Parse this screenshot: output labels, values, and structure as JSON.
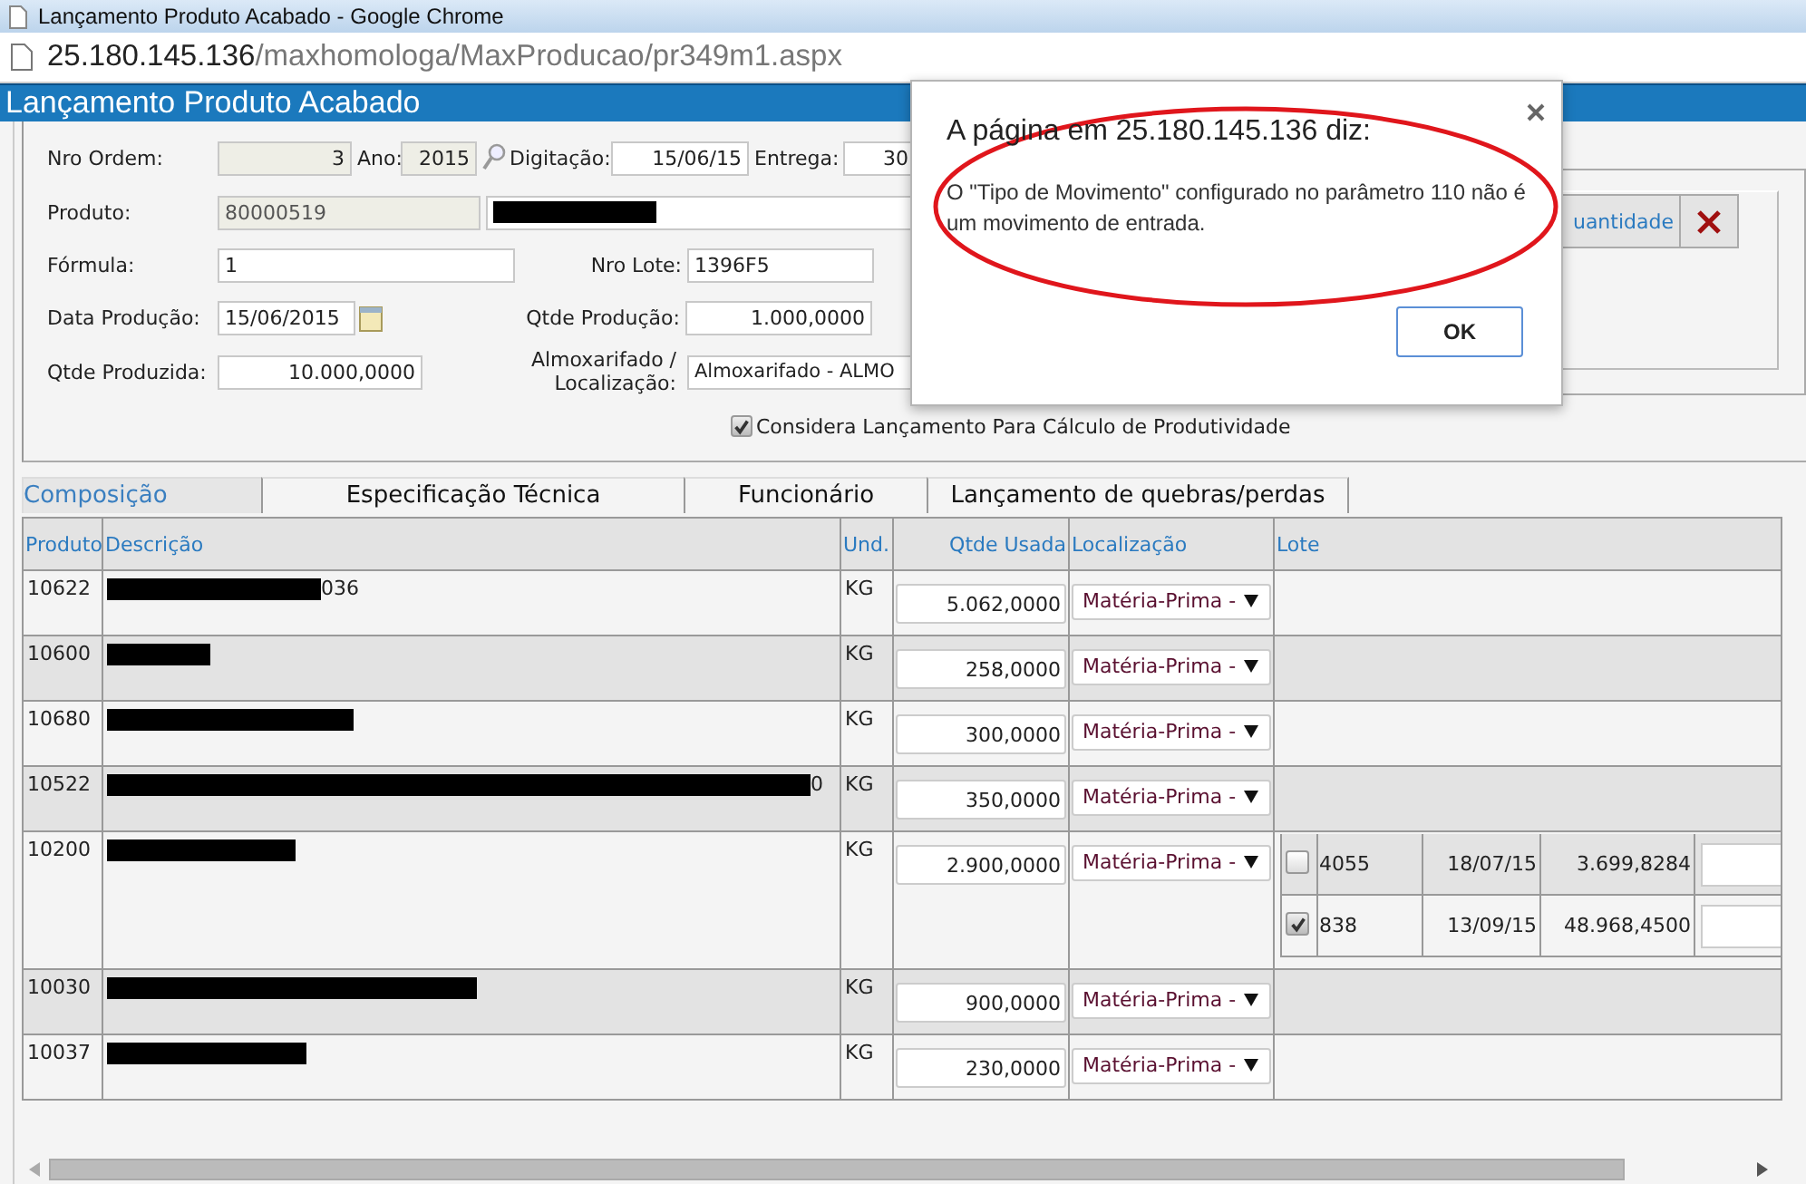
{
  "window": {
    "title": "Lançamento Produto Acabado - Google Chrome"
  },
  "address_bar": {
    "host": "25.180.145.136",
    "path": "/maxhomologa/MaxProducao/pr349m1.aspx"
  },
  "page_title": "Lançamento Produto Acabado",
  "form": {
    "nro_ordem": {
      "label": "Nro Ordem:",
      "value": "3"
    },
    "ano": {
      "label": "Ano:",
      "value": "2015"
    },
    "digitacao": {
      "label": "Digitação:",
      "value": "15/06/15"
    },
    "entrega": {
      "label": "Entrega:",
      "value": "30"
    },
    "produto": {
      "label": "Produto:",
      "code": "80000519",
      "name_redacted": true
    },
    "formula": {
      "label": "Fórmula:",
      "value": "1"
    },
    "nro_lote": {
      "label": "Nro Lote:",
      "value": "1396F5"
    },
    "data_producao": {
      "label": "Data Produção:",
      "value": "15/06/2015"
    },
    "qtde_producao": {
      "label": "Qtde Produção:",
      "value": "1.000,0000"
    },
    "qtde_produzida": {
      "label": "Qtde Produzida:",
      "value": "10.000,0000"
    },
    "almoxarifado": {
      "label": "Almoxarifado / Localização:",
      "value": "Almoxarifado - ALMO"
    },
    "considera": {
      "label": "Considera Lançamento Para Cálculo de Produtividade",
      "checked": true
    }
  },
  "side_panel": {
    "quantity_button": "uantidade"
  },
  "tabs": [
    {
      "label": "Composição",
      "selected": true
    },
    {
      "label": "Especificação Técnica",
      "selected": false
    },
    {
      "label": "Funcionário",
      "selected": false
    },
    {
      "label": "Lançamento de quebras/perdas",
      "selected": false
    }
  ],
  "table": {
    "columns": [
      "Produto",
      "Descrição",
      "Und.",
      "Qtde Usada",
      "Localização",
      "Lote"
    ],
    "rows": [
      {
        "produto": "10622",
        "descricao": {
          "redacted": true,
          "tail": "036"
        },
        "und": "KG",
        "qtde_usada": "5.062,0000",
        "localizacao": "Matéria-Prima -"
      },
      {
        "produto": "10600",
        "descricao": {
          "redacted": true
        },
        "und": "KG",
        "qtde_usada": "258,0000",
        "localizacao": "Matéria-Prima -"
      },
      {
        "produto": "10680",
        "descricao": {
          "redacted": true
        },
        "und": "KG",
        "qtde_usada": "300,0000",
        "localizacao": "Matéria-Prima -"
      },
      {
        "produto": "10522",
        "descricao": {
          "redacted": true,
          "tail": "0"
        },
        "und": "KG",
        "qtde_usada": "350,0000",
        "localizacao": "Matéria-Prima -"
      },
      {
        "produto": "10200",
        "descricao": {
          "redacted": true
        },
        "und": "KG",
        "qtde_usada": "2.900,0000",
        "localizacao": "Matéria-Prima -",
        "lotes": [
          {
            "checked": false,
            "lote": "4055",
            "data": "18/07/15",
            "saldo": "3.699,8284"
          },
          {
            "checked": true,
            "lote": "838",
            "data": "13/09/15",
            "saldo": "48.968,4500"
          }
        ]
      },
      {
        "produto": "10030",
        "descricao": {
          "redacted": true
        },
        "und": "KG",
        "qtde_usada": "900,0000",
        "localizacao": "Matéria-Prima -"
      },
      {
        "produto": "10037",
        "descricao": {
          "redacted": true
        },
        "und": "KG",
        "qtde_usada": "230,0000",
        "localizacao": "Matéria-Prima -"
      }
    ]
  },
  "dialog": {
    "title": "A página em 25.180.145.136 diz:",
    "message": "O \"Tipo de Movimento\" configurado no parâmetro 110 não é um movimento de entrada.",
    "ok_button": "OK",
    "highlighted": true
  }
}
